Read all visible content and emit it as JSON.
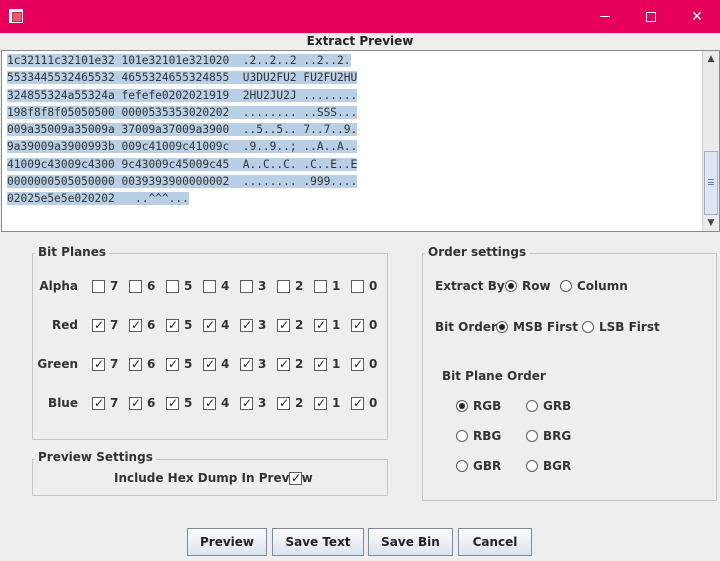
{
  "window": {
    "title": ""
  },
  "preview": {
    "title": "Extract Preview",
    "lines": [
      {
        "text": "1c32111c32101e32 101e32101e321020  .2..2..2 ..2..2.",
        "selected": true
      },
      {
        "text": "5533445532465532 4655324655324855  U3DU2FU2 FU2FU2HU",
        "selected": true
      },
      {
        "text": "324855324a55324a fefefe0202021919  2HU2JU2J ........",
        "selected": true
      },
      {
        "text": "198f8f8f05050500 0000535353020202  ........ ..SSS...",
        "selected": true
      },
      {
        "text": "009a35009a35009a 37009a37009a3900  ..5..5.. 7..7..9.",
        "selected": true
      },
      {
        "text": "9a39009a3900993b 009c41009c41009c  .9..9..; ..A..A..",
        "selected": true
      },
      {
        "text": "41009c43009c4300 9c43009c45009c45  A..C..C. .C..E..E",
        "selected": true
      },
      {
        "text": "0000000505050000 0039393900000002  ........ .999....",
        "selected": true
      },
      {
        "text": "02025e5e5e020202   ..^^^...",
        "selected": true
      }
    ]
  },
  "bit_planes": {
    "title": "Bit Planes",
    "bits": [
      "7",
      "6",
      "5",
      "4",
      "3",
      "2",
      "1",
      "0"
    ],
    "rows": [
      {
        "label": "Alpha",
        "checked": [
          false,
          false,
          false,
          false,
          false,
          false,
          false,
          false
        ]
      },
      {
        "label": "Red",
        "checked": [
          true,
          true,
          true,
          true,
          true,
          true,
          true,
          true
        ]
      },
      {
        "label": "Green",
        "checked": [
          true,
          true,
          true,
          true,
          true,
          true,
          true,
          true
        ]
      },
      {
        "label": "Blue",
        "checked": [
          true,
          true,
          true,
          true,
          true,
          true,
          true,
          true
        ]
      }
    ]
  },
  "preview_settings": {
    "title": "Preview Settings",
    "hex_dump_label": "Include Hex Dump In Preview",
    "hex_dump_checked": true
  },
  "order_settings": {
    "title": "Order settings",
    "extract_by_label": "Extract By",
    "extract_by_options": [
      "Row",
      "Column"
    ],
    "extract_by_selected": "Row",
    "bit_order_label": "Bit Order",
    "bit_order_options": [
      "MSB First",
      "LSB First"
    ],
    "bit_order_selected": "MSB First",
    "plane_order_label": "Bit Plane Order",
    "plane_order_options": [
      "RGB",
      "GRB",
      "RBG",
      "BRG",
      "GBR",
      "BGR"
    ],
    "plane_order_selected": "RGB"
  },
  "buttons": {
    "preview": "Preview",
    "save_text": "Save Text",
    "save_bin": "Save Bin",
    "cancel": "Cancel"
  },
  "colors": {
    "titlebar": "#e6005c",
    "selection": "#b8cfe5",
    "background": "#eeeeee"
  }
}
